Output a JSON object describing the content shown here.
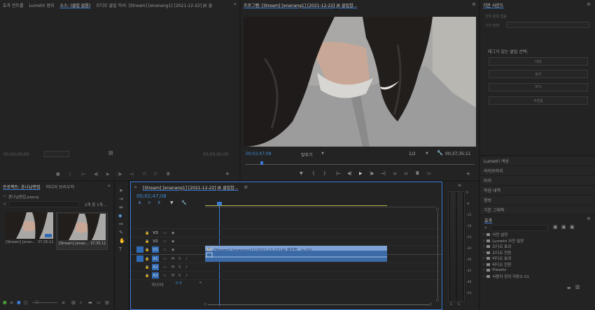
{
  "source_panel": {
    "tabs": [
      "효과 컨트롤",
      "Lumetri 범위",
      "소스: (클립 없음)",
      "오디오 클립 믹서: [Stream] [enanang1] [2021-12-22] JK 클"
    ],
    "timecode_left": "00;00;00;00",
    "timecode_right": "00;00;00;00"
  },
  "program_panel": {
    "title": "프로그램: [Stream] [enanang1] [2021-12-22] JK 클립합...",
    "timecode": "00;02;47;08",
    "fit": "맞추기",
    "ratio": "1/2",
    "duration": "00;37;35;11"
  },
  "essential_sound": {
    "title": "기본 사운드",
    "subtitle": "선택 항목 없음",
    "preset_label": "사전 설정:",
    "prompt": "태그가 있는 클립 선택:",
    "buttons": [
      "대화",
      "음악",
      "SFX",
      "주변음"
    ]
  },
  "lumetri_items": [
    "Lumetri 색상",
    "라이브러리",
    "마커",
    "작업 내역",
    "정보",
    "기본 그래픽"
  ],
  "effects": {
    "title": "효과",
    "folders": [
      "사전 설정",
      "Lumetri 사전 설정",
      "오디오 효과",
      "오디오 전환",
      "비디오 효과",
      "비디오 전환",
      "Presets",
      "사용자 정의 저장소 01"
    ]
  },
  "project_panel": {
    "tabs": [
      "프로젝트: 흔나남편집",
      "미디어 브라우저"
    ],
    "project_file": "흔나남편집.prproj",
    "item_count": "2개 중 1개...",
    "clips": [
      {
        "name": "[Stream] [enan...",
        "duration": "37;35;11"
      },
      {
        "name": "[Stream] [enan...",
        "duration": "37;35;11"
      }
    ]
  },
  "timeline": {
    "tab": "[Stream] [enanang1] [2021-12-22] JK 클립합...",
    "timecode": "00;02;47;08",
    "tracks_video": [
      "V3",
      "V2",
      "V1"
    ],
    "tracks_audio": [
      "A1",
      "A2",
      "A3"
    ],
    "master_label": "마스터",
    "master_value": "0.0",
    "clip_label": "[Stream] [enanang1] [2021-12-22] JK 클립합...ts [V]"
  },
  "audio_meter": {
    "scale": [
      "0",
      "-6",
      "-12",
      "-18",
      "-24",
      "-30",
      "-36",
      "-42",
      "-48",
      "-54"
    ],
    "footer": [
      "S",
      "S"
    ]
  },
  "colors": {
    "accent": "#3a7bd5",
    "timecode": "#3f8fd8",
    "clip_video": "#7ea2d6",
    "clip_audio": "#3c6aa6",
    "meter_green": "#4a9a3a"
  }
}
